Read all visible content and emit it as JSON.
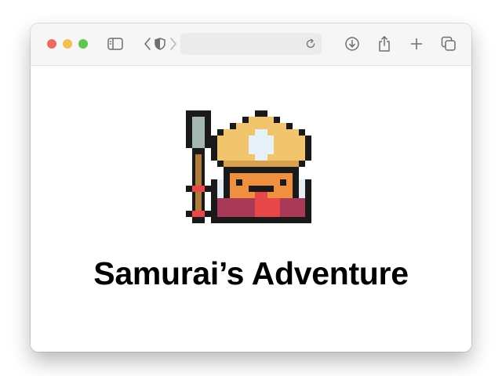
{
  "browser": {
    "address_bar": {
      "url": ""
    },
    "traffic_lights": {
      "close_color": "#ec6a5e",
      "minimize_color": "#f4bf4f",
      "zoom_color": "#61c554"
    },
    "toolbar_icons": [
      "sidebar-icon",
      "back-icon",
      "privacy-shield-icon",
      "forward-icon",
      "reload-icon",
      "download-icon",
      "share-icon",
      "new-tab-icon",
      "tab-overview-icon"
    ]
  },
  "page": {
    "title": "Samurai’s Adventure",
    "sprite": {
      "name": "samurai-pixel-sprite",
      "colors": {
        "outline": "#1a1a1a",
        "hat": "#f2c46e",
        "hat_shade": "#d9a24e",
        "hat_star": "#e6f2f7",
        "face": "#f0903f",
        "mouth": "#e8474a",
        "body": "#a83a58",
        "armor": "#e4eef4",
        "spear_blade": "#a4b8b0",
        "spear_shaft": "#b07a3a",
        "spear_band": "#e8474a"
      }
    }
  }
}
